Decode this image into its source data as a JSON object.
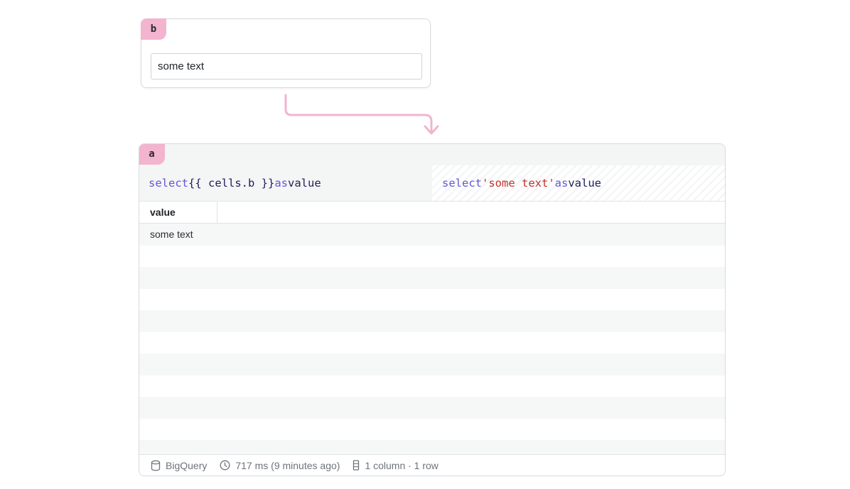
{
  "cell_b": {
    "tag": "b",
    "input_value": "some text"
  },
  "cell_a": {
    "tag": "a",
    "editor": {
      "kw_select": "select",
      "template": "{{ cells.b }}",
      "kw_as": "as",
      "alias": "value"
    },
    "compiled": {
      "kw_select": "select",
      "literal": "'some text'",
      "kw_as": "as",
      "alias": "value"
    },
    "table": {
      "columns": [
        "value"
      ],
      "rows": [
        [
          "some text"
        ],
        [
          ""
        ],
        [
          ""
        ],
        [
          ""
        ],
        [
          ""
        ],
        [
          ""
        ],
        [
          ""
        ],
        [
          ""
        ],
        [
          ""
        ],
        [
          ""
        ],
        [
          ""
        ]
      ]
    },
    "footer": {
      "source": "BigQuery",
      "duration": "717 ms (9 minutes ago)",
      "shape": "1 column · 1 row"
    }
  },
  "colors": {
    "tag_bg": "#f2b4cf",
    "keyword": "#6157d6",
    "identifier": "#1b1f5e",
    "string": "#c3322b"
  }
}
